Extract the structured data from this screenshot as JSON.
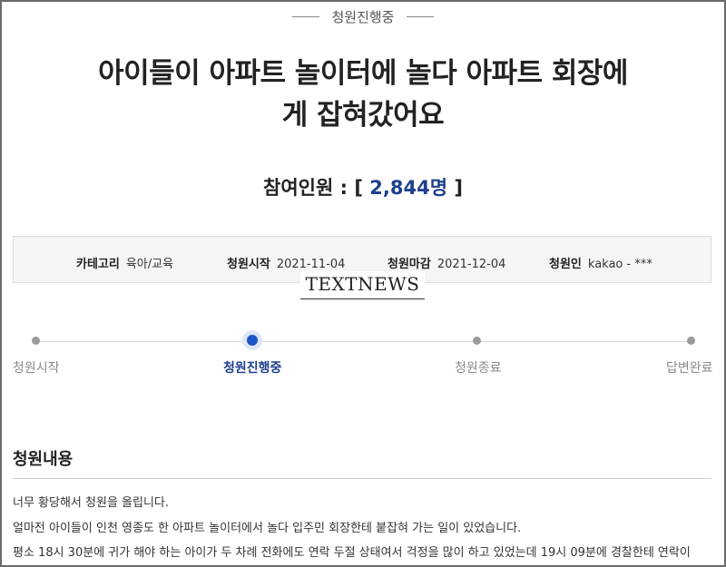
{
  "status_label": "청원진행중",
  "title_line1": "아이들이 아파트 놀이터에 놀다 아파트 회장에",
  "title_line2": "게 잡혀갔어요",
  "participants": {
    "prefix": "참여인원 : [ ",
    "count": "2,844명",
    "suffix": " ]"
  },
  "info": {
    "category_label": "카테고리",
    "category_value": "육아/교육",
    "start_label": "청원시작",
    "start_value": "2021-11-04",
    "end_label": "청원마감",
    "end_value": "2021-12-04",
    "author_label": "청원인",
    "author_value": "kakao - ***"
  },
  "watermark": "TEXTNEWS",
  "timeline": [
    {
      "label": "청원시작",
      "active": false
    },
    {
      "label": "청원진행중",
      "active": true
    },
    {
      "label": "청원종료",
      "active": false
    },
    {
      "label": "답변완료",
      "active": false
    }
  ],
  "section_title": "청원내용",
  "body_lines": [
    "너무 황당해서 청원을 올립니다.",
    "얼마전 아이들이 인천 영종도 한 아파트 놀이터에서 놀다 입주민 회장한테 붙잡혀 가는 일이 있었습니다.",
    "평소 18시 30분에 귀가 해야 하는 아이가 두 차례 전화에도 연락 두절 상태여서 걱정을 많이 하고 있었는데 19시 09분에 경찰한테 연락이"
  ]
}
